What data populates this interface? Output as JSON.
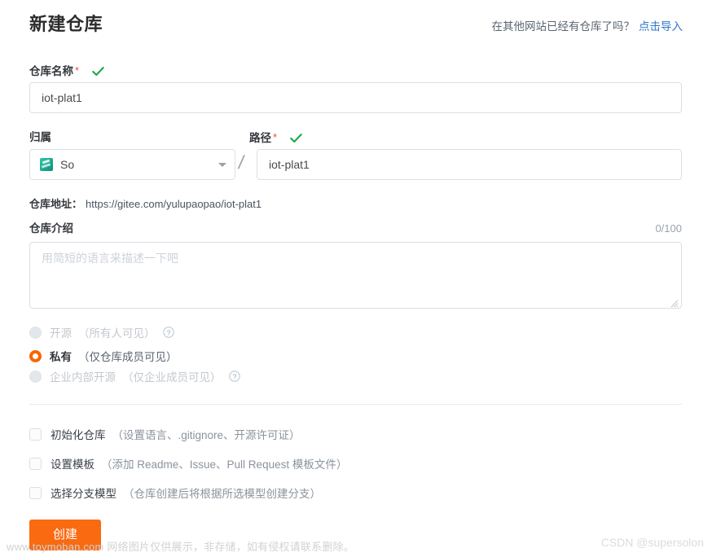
{
  "header": {
    "title": "新建仓库",
    "import_prompt": "在其他网站已经有仓库了吗？",
    "import_link": "点击导入"
  },
  "repo_name": {
    "label": "仓库名称",
    "required_mark": "*",
    "value": "iot-plat1",
    "placeholder": "",
    "valid_icon": "check-icon"
  },
  "owner": {
    "label": "归属",
    "selected": "So",
    "avatar_icon": "user-avatar-icon",
    "caret_icon": "chevron-down-icon"
  },
  "path": {
    "label": "路径",
    "required_mark": "*",
    "separator": "/",
    "value": "iot-plat1",
    "placeholder": "",
    "valid_icon": "check-icon"
  },
  "repo_address": {
    "label": "仓库地址：",
    "url": "https://gitee.com/yulupaopao/iot-plat1"
  },
  "description": {
    "label": "仓库介绍",
    "counter": "0/100",
    "value": "",
    "placeholder": "用简短的语言来描述一下吧"
  },
  "visibility": {
    "options": [
      {
        "main": "开源",
        "sub": "（所有人可见）",
        "selected": false,
        "disabled": true,
        "help": true
      },
      {
        "main": "私有",
        "sub": "（仅仓库成员可见）",
        "selected": true,
        "disabled": false,
        "help": false
      },
      {
        "main": "企业内部开源",
        "sub": "（仅企业成员可见）",
        "selected": false,
        "disabled": true,
        "help": true
      }
    ]
  },
  "options": {
    "items": [
      {
        "main": "初始化仓库",
        "sub": "（设置语言、.gitignore、开源许可证）",
        "checked": false
      },
      {
        "main": "设置模板",
        "sub": "（添加 Readme、Issue、Pull Request 模板文件）",
        "checked": false
      },
      {
        "main": "选择分支模型",
        "sub": "（仓库创建后将根据所选模型创建分支）",
        "checked": false
      }
    ]
  },
  "submit": {
    "label": "创建"
  },
  "watermarks": {
    "left": "www.toymoban.com 网络图片仅供展示，非存储，如有侵权请联系删除。",
    "right": "CSDN @supersolon"
  },
  "colors": {
    "accent_orange": "#f96a11",
    "radio_orange": "#fa6400",
    "link_blue": "#2f76c7",
    "required_red": "#e8503a",
    "valid_green": "#23a94f"
  }
}
